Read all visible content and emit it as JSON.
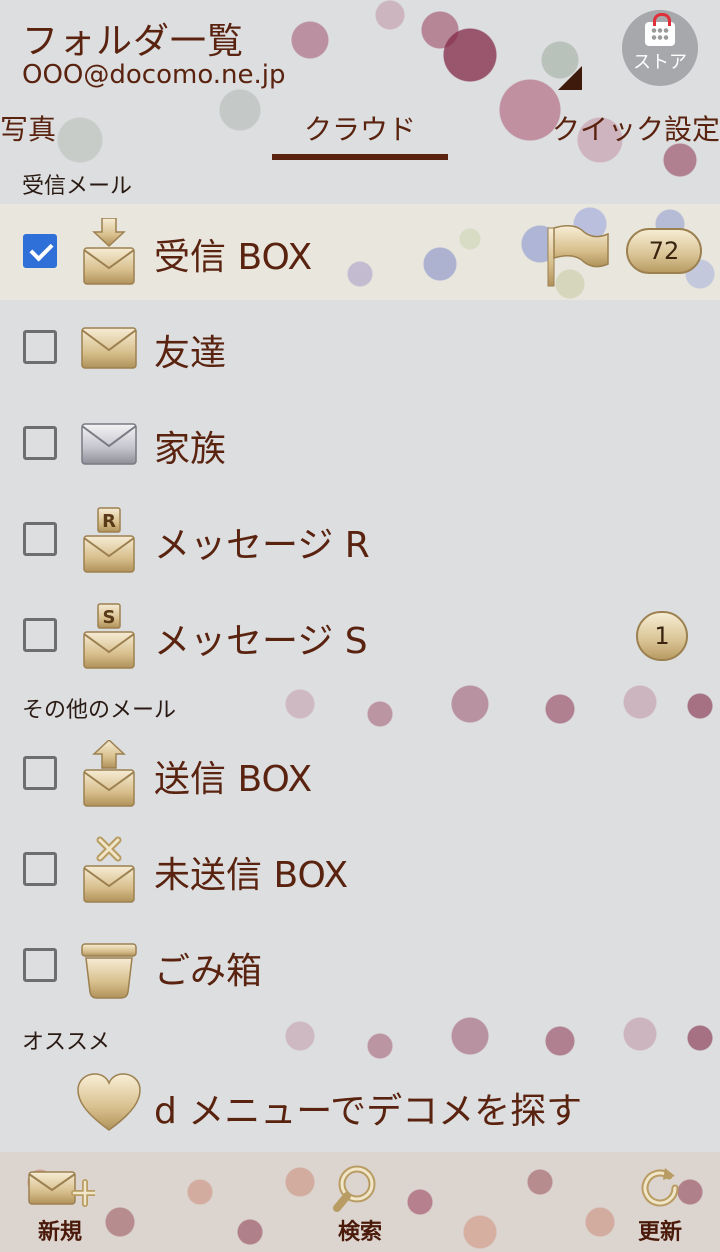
{
  "header": {
    "title": "フォルダ一覧",
    "account": "OOO@docomo.ne.jp",
    "store_label": "ストア"
  },
  "tabs": [
    {
      "label": "写真",
      "active": false
    },
    {
      "label": "クラウド",
      "active": true
    },
    {
      "label": "クイック設定",
      "active": false
    }
  ],
  "sections": {
    "inbox_mail": "受信メール",
    "other_mail": "その他のメール",
    "recommend": "オススメ"
  },
  "folders": [
    {
      "label": "受信 BOX",
      "checked": true,
      "icon": "inbox-envelope-icon",
      "badge": "72",
      "flagged": true
    },
    {
      "label": "友達",
      "checked": false,
      "icon": "envelope-icon",
      "badge": ""
    },
    {
      "label": "家族",
      "checked": false,
      "icon": "silver-envelope-icon",
      "badge": ""
    },
    {
      "label": "メッセージ R",
      "checked": false,
      "icon": "message-r-envelope-icon",
      "badge": ""
    },
    {
      "label": "メッセージ S",
      "checked": false,
      "icon": "message-s-envelope-icon",
      "badge": "1"
    }
  ],
  "other_folders": [
    {
      "label": "送信 BOX",
      "checked": false,
      "icon": "outbox-envelope-icon"
    },
    {
      "label": "未送信 BOX",
      "checked": false,
      "icon": "unsent-envelope-icon"
    },
    {
      "label": "ごみ箱",
      "checked": false,
      "icon": "trash-box-icon"
    }
  ],
  "recommend": {
    "label": "d メニューでデコメを探す"
  },
  "toolbar": {
    "new_label": "新規",
    "search_label": "検索",
    "refresh_label": "更新"
  },
  "colors": {
    "text_brown": "#5a2310",
    "background": "#dcdedf",
    "checkbox_blue": "#2f6fd8",
    "gold": "#d9c394"
  }
}
